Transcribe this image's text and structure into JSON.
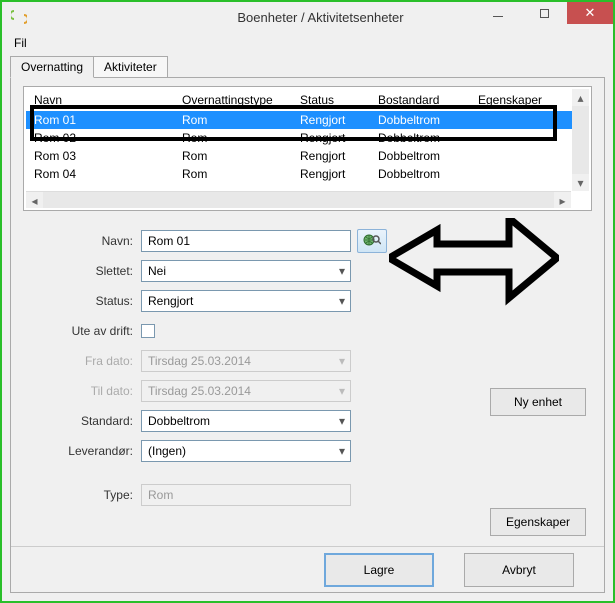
{
  "window": {
    "title": "Boenheter / Aktivitetsenheter",
    "menu_fil": "Fil"
  },
  "tabs": {
    "overnatting": "Overnatting",
    "aktiviteter": "Aktiviteter"
  },
  "list": {
    "headers": {
      "navn": "Navn",
      "type": "Overnattingstype",
      "status": "Status",
      "bostandard": "Bostandard",
      "egenskaper": "Egenskaper"
    },
    "rows": [
      {
        "navn": "Rom 01",
        "type": "Rom",
        "status": "Rengjort",
        "bostandard": "Dobbeltrom",
        "selected": true
      },
      {
        "navn": "Rom 02",
        "type": "Rom",
        "status": "Rengjort",
        "bostandard": "Dobbeltrom",
        "selected": false
      },
      {
        "navn": "Rom 03",
        "type": "Rom",
        "status": "Rengjort",
        "bostandard": "Dobbeltrom",
        "selected": false
      },
      {
        "navn": "Rom 04",
        "type": "Rom",
        "status": "Rengjort",
        "bostandard": "Dobbeltrom",
        "selected": false
      }
    ]
  },
  "form": {
    "navn_label": "Navn:",
    "navn_value": "Rom 01",
    "slettet_label": "Slettet:",
    "slettet_value": "Nei",
    "status_label": "Status:",
    "status_value": "Rengjort",
    "ute_label": "Ute av drift:",
    "ute_checked": false,
    "fra_label": "Fra dato:",
    "fra_value": "Tirsdag 25.03.2014",
    "til_label": "Til dato:",
    "til_value": "Tirsdag 25.03.2014",
    "standard_label": "Standard:",
    "standard_value": "Dobbeltrom",
    "leverandor_label": "Leverandør:",
    "leverandor_value": "(Ingen)",
    "type_label": "Type:",
    "type_value": "Rom"
  },
  "buttons": {
    "ny_enhet": "Ny enhet",
    "egenskaper": "Egenskaper",
    "lagre": "Lagre",
    "avbryt": "Avbryt"
  }
}
